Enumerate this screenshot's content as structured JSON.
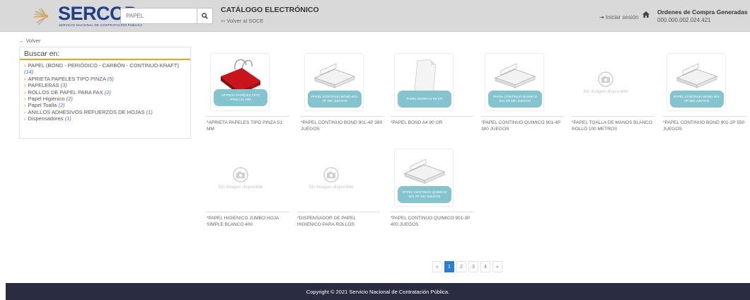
{
  "header": {
    "logo_text": "SERCOP",
    "logo_subtitle": "SERVICIO NACIONAL DE CONTRATACIÓN PÚBLICA",
    "search_value": "PAPEL",
    "catalog_title": "CATÁLOGO ELECTRÓNICO",
    "back_to_soce": "Volver al SOCE",
    "login": "Iniciar sesión",
    "orders_title": "Ordenes de Compra Generadas",
    "orders_number": "000.000.002.024.421",
    "colors": {
      "bar": "#d9d9d9",
      "brand": "#1f3f86",
      "accent": "#f0a020"
    }
  },
  "back_link": "Volver",
  "sidebar": {
    "title": "Buscar en:",
    "items": [
      {
        "label": "PAPEL (BOND - PERIÓDICO - CARBÓN - CONTINUO-KRAFT)",
        "count": "(14)"
      },
      {
        "label": "APRIETA PAPELES TIPO PINZA",
        "count": "(5)"
      },
      {
        "label": "PAPELERAS",
        "count": "(3)"
      },
      {
        "label": "ROLLOS DE PAPEL PARA FAX",
        "count": "(2)"
      },
      {
        "label": "Papel Higiénico",
        "count": "(2)"
      },
      {
        "label": "Papel Toalla",
        "count": "(2)"
      },
      {
        "label": "ANILLOS ADHESIVOS REFUERZOS DE HOJAS",
        "count": "(1)"
      },
      {
        "label": "Dispensadores",
        "count": "(1)"
      }
    ]
  },
  "products": [
    {
      "image": "binder-clip-icon",
      "badge": "APRIETA PAPELES TIPO PINZA 51 MM",
      "caption": "*APRIETA PAPELES TIPO PINZA 51 MM"
    },
    {
      "image": "paper-box-icon",
      "badge": "PAPEL CONTINUO BOND 901-4P 380 JUEGOS",
      "caption": "*PAPEL CONTINUO BOND 901-4P 380 JUEGOS"
    },
    {
      "image": "paper-sheet-icon",
      "badge": "PAPEL BOND A4 90 GR",
      "caption": "*PAPEL BOND A4 90 GR"
    },
    {
      "image": "paper-box-icon",
      "badge": "PAPEL CONTINUO QUIMICO 901-4P 380 JUEGOS",
      "caption": "*PAPEL CONTINUO QUIMICO 901-4P 380 JUEGOS"
    },
    {
      "image": "no-image-icon",
      "noimg": "Sin imagen disponible",
      "caption": "*PAPEL TOALLA DE MANOS BLANCO ROLLO 100 METROS"
    },
    {
      "image": "paper-box-icon",
      "badge": "PAPEL CONTINUO BOND 901-2P 550 JUEGOS",
      "caption": "*PAPEL CONTINUO BOND 901-2P 550 JUEGOS"
    },
    {
      "image": "no-image-icon",
      "noimg": "Sin imagen disponible",
      "caption": "*PAPEL HIGIENICO JUMBO HOJA SIMPLE BLANCO 400"
    },
    {
      "image": "no-image-icon",
      "noimg": "Sin imagen disponible",
      "caption": "*DISPENSADOR DE PAPEL HIGIENICO PARA ROLLOS"
    },
    {
      "image": "paper-box-icon",
      "badge": "PAPEL CONTINUO QUIMICO 901-3P 400 JUEGOS",
      "caption": "*PAPEL CONTINUO QUIMICO 901-3P 400 JUEGOS"
    }
  ],
  "pagination": {
    "prev": "«",
    "pages": [
      "1",
      "2",
      "3",
      "4"
    ],
    "current": "1",
    "next": "»"
  },
  "footer": {
    "copyright": "Copyright © 2021 Servicio Nacional de Contratación Pública."
  }
}
